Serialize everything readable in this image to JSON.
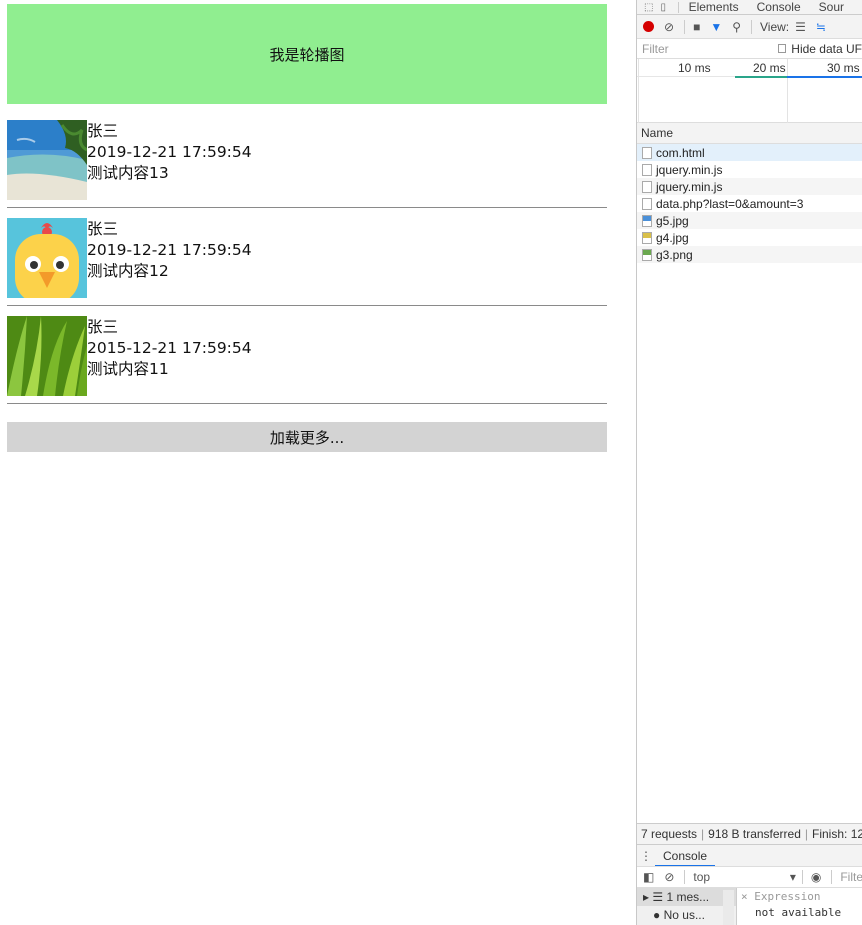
{
  "site": {
    "banner": "我是轮播图",
    "items": [
      {
        "name": "张三",
        "time": "2019-12-21 17:59:54",
        "content": "测试内容13",
        "thumb": "beach"
      },
      {
        "name": "张三",
        "time": "2019-12-21 17:59:54",
        "content": "测试内容12",
        "thumb": "chick"
      },
      {
        "name": "张三",
        "time": "2015-12-21 17:59:54",
        "content": "测试内容11",
        "thumb": "grass"
      }
    ],
    "load_more": "加载更多..."
  },
  "devtools": {
    "tabs": [
      "Elements",
      "Console",
      "Sour"
    ],
    "toolbar": {
      "view_label": "View:",
      "hide_data_label": "Hide data UF",
      "filter_placeholder": "Filter"
    },
    "timeline_ticks": [
      "10 ms",
      "20 ms",
      "30 ms"
    ],
    "name_header": "Name",
    "requests": [
      "com.html",
      "jquery.min.js",
      "jquery.min.js",
      "data.php?last=0&amount=3",
      "g5.jpg",
      "g4.jpg",
      "g3.png"
    ],
    "status": {
      "requests": "7 requests",
      "transferred": "918 B transferred",
      "finish": "Finish: 12"
    },
    "drawer_tab": "Console",
    "context": "top",
    "console_filter": "Filte",
    "sidebar": {
      "messages": "1 mes...",
      "user": "No us..."
    },
    "expression": {
      "label": "Expression",
      "value": "not available"
    }
  }
}
